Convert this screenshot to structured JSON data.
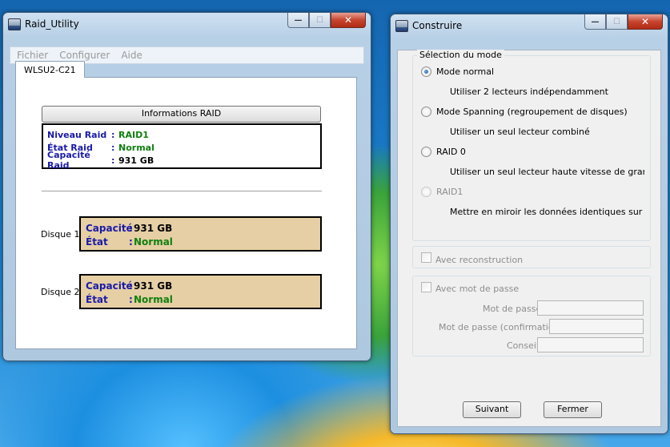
{
  "raid_window": {
    "title": "Raid_Utility",
    "menu": [
      "Fichier",
      "Configurer",
      "Aide"
    ],
    "tab": "WLSU2-C21",
    "info_button": "Informations RAID",
    "info": {
      "niveau_label": "Niveau Raid",
      "niveau_value": "RAID1",
      "etat_label": "État Raid",
      "etat_value": "Normal",
      "capacite_label": "Capacité Raid",
      "capacite_value": "931 GB"
    },
    "disks": [
      {
        "name": "Disque 1",
        "capacite_label": "Capacité",
        "capacite_value": "931 GB",
        "etat_label": "État",
        "etat_value": "Normal"
      },
      {
        "name": "Disque 2",
        "capacite_label": "Capacité",
        "capacite_value": "931 GB",
        "etat_label": "État",
        "etat_value": "Normal"
      }
    ]
  },
  "construire_window": {
    "title": "Construire",
    "mode_group": "Sélection du mode",
    "modes": [
      {
        "label": "Mode normal",
        "desc": "Utiliser 2 lecteurs indépendamment",
        "checked": true,
        "disabled": false
      },
      {
        "label": "Mode Spanning (regroupement de disques)",
        "desc": "Utiliser un seul lecteur combiné",
        "checked": false,
        "disabled": false
      },
      {
        "label": "RAID 0",
        "desc": "Utiliser un seul lecteur haute vitesse de grande capacité",
        "checked": false,
        "disabled": false
      },
      {
        "label": "RAID1",
        "desc": "Mettre en miroir les données identiques sur les deux lecteurs",
        "checked": false,
        "disabled": true
      }
    ],
    "reconstruction": "Avec reconstruction",
    "password_group": "Avec mot de passe",
    "password_label": "Mot de passe",
    "password_confirm_label": "Mot de passe (confirmation)",
    "hint_label": "Conseil",
    "next_button": "Suivant",
    "close_button": "Fermer"
  }
}
